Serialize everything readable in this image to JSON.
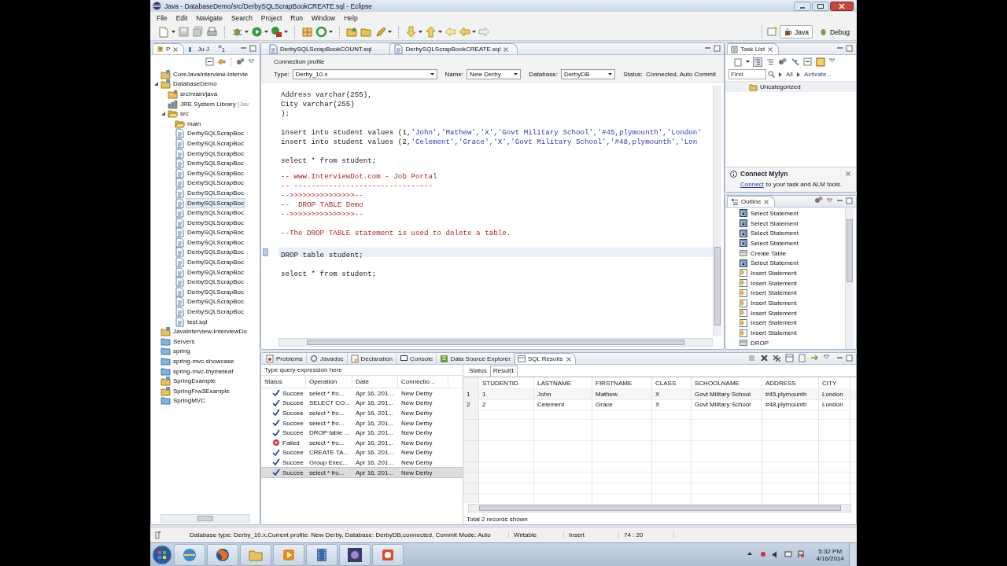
{
  "window": {
    "title": "Java - DatabaseDemo/src/DerbySQLScrapBookCREATE.sql - Eclipse"
  },
  "menu": [
    "File",
    "Edit",
    "Navigate",
    "Search",
    "Project",
    "Run",
    "Window",
    "Help"
  ],
  "perspectives": [
    {
      "label": "Java",
      "selected": true
    },
    {
      "label": "Debug",
      "selected": false
    }
  ],
  "explorer": {
    "tabs": [
      {
        "label": "P",
        "selected": true
      },
      {
        "label": "Ju J",
        "selected": false
      }
    ],
    "overflow": {
      "glyph": "»",
      "count": "1"
    },
    "tree": [
      {
        "label": "CoreJavaInterview-Intervie",
        "kind": "project",
        "selected": false
      },
      {
        "label": "DatabaseDemo",
        "kind": "project",
        "selected": false,
        "expanded": true,
        "children": [
          {
            "label": "src/main/java",
            "kind": "source",
            "selected": false
          },
          {
            "label": "JRE System Library",
            "suffix": "[Jav",
            "kind": "library",
            "selected": false
          },
          {
            "label": "src",
            "kind": "open",
            "selected": false,
            "expanded": true,
            "children": [
              {
                "label": "main",
                "kind": "open",
                "selected": false
              },
              {
                "label": "DerbySQLScrapBoc",
                "kind": "file",
                "selected": false
              },
              {
                "label": "DerbySQLScrapBoc",
                "kind": "file",
                "selected": false
              },
              {
                "label": "DerbySQLScrapBoc",
                "kind": "file",
                "selected": false
              },
              {
                "label": "DerbySQLScrapBoc",
                "kind": "file",
                "selected": false
              },
              {
                "label": "DerbySQLScrapBoc",
                "kind": "file",
                "selected": false
              },
              {
                "label": "DerbySQLScrapBoc",
                "kind": "file",
                "selected": false
              },
              {
                "label": "DerbySQLScrapBoc",
                "kind": "file",
                "selected": false
              },
              {
                "label": "DerbySQLScrapBoc",
                "kind": "file",
                "selected": true
              },
              {
                "label": "DerbySQLScrapBoc",
                "kind": "file",
                "selected": false
              },
              {
                "label": "DerbySQLScrapBoc",
                "kind": "file",
                "selected": false
              },
              {
                "label": "DerbySQLScrapBoc",
                "kind": "file",
                "selected": false
              },
              {
                "label": "DerbySQLScrapBoc",
                "kind": "file",
                "selected": false
              },
              {
                "label": "DerbySQLScrapBoc",
                "kind": "file",
                "selected": false
              },
              {
                "label": "DerbySQLScrapBoc",
                "kind": "file",
                "selected": false
              },
              {
                "label": "DerbySQLScrapBoc",
                "kind": "file",
                "selected": false
              },
              {
                "label": "DerbySQLScrapBoc",
                "kind": "file",
                "selected": false
              },
              {
                "label": "DerbySQLScrapBoc",
                "kind": "file",
                "selected": false
              },
              {
                "label": "DerbySQLScrapBoc",
                "kind": "file",
                "selected": false
              },
              {
                "label": "DerbySQLScrapBoc",
                "kind": "file",
                "selected": false
              },
              {
                "label": "test.sql",
                "kind": "file",
                "selected": false
              }
            ]
          }
        ]
      },
      {
        "label": "JavaInterview-InterviewDo",
        "kind": "project",
        "selected": false
      },
      {
        "label": "Servers",
        "kind": "folder",
        "selected": false
      },
      {
        "label": "spring",
        "kind": "folder",
        "selected": false
      },
      {
        "label": "spring-mvc-showcase",
        "kind": "folder",
        "selected": false
      },
      {
        "label": "spring-mvc-thymeleaf",
        "kind": "folder",
        "selected": false
      },
      {
        "label": "SpringExample",
        "kind": "project",
        "selected": false
      },
      {
        "label": "SpringFrw3Example",
        "kind": "project",
        "selected": false
      },
      {
        "label": "SpringMVC",
        "kind": "folder",
        "selected": false
      }
    ]
  },
  "editor": {
    "tabs": [
      {
        "label": "DerbySQLScrapBookCOUNT.sql",
        "selected": false
      },
      {
        "label": "DerbySQLScrapBookCREATE.sql",
        "selected": true
      }
    ],
    "connection": {
      "heading": "Connection profile",
      "fields": [
        {
          "label": "Type:",
          "value": "Derby_10.x"
        },
        {
          "label": "Name:",
          "value": "New Derby"
        },
        {
          "label": "Database:",
          "value": "DerbyDB"
        }
      ],
      "status_label": "Status:",
      "status": "Connected, Auto Commit"
    },
    "lines": [
      {
        "kind": "code",
        "current": false,
        "segments": [
          {
            "text": "Address varchar(255),",
            "kind": "plain"
          }
        ]
      },
      {
        "kind": "code",
        "current": false,
        "segments": [
          {
            "text": "City varchar(255)",
            "kind": "plain"
          }
        ]
      },
      {
        "kind": "code",
        "current": false,
        "segments": [
          {
            "text": ");",
            "kind": "plain"
          }
        ]
      },
      {
        "kind": "blank",
        "current": false
      },
      {
        "kind": "code",
        "current": false,
        "segments": [
          {
            "text": "insert into student values (1,",
            "kind": "plain"
          },
          {
            "text": "'John','Mathew','X','Govt Military School','#45,plymounth','London'",
            "kind": "string"
          }
        ]
      },
      {
        "kind": "code",
        "current": false,
        "segments": [
          {
            "text": "insert into student values (2,",
            "kind": "plain"
          },
          {
            "text": "'Celement','Grace','X','Govt Military School','#48,plymounth','Lon",
            "kind": "string"
          }
        ]
      },
      {
        "kind": "blank",
        "current": false
      },
      {
        "kind": "code",
        "current": false,
        "segments": [
          {
            "text": "select * from student;",
            "kind": "plain"
          }
        ]
      },
      {
        "kind": "blank",
        "current": false
      },
      {
        "kind": "comment",
        "current": false,
        "segments": [
          {
            "text": "-- www.InterviewDot.com - Job Portal",
            "kind": "plain"
          }
        ]
      },
      {
        "kind": "comment",
        "current": false,
        "segments": [
          {
            "text": "-- --------------------------------",
            "kind": "plain"
          }
        ]
      },
      {
        "kind": "comment",
        "current": false,
        "segments": [
          {
            "text": "-->>>>>>>>>>>>>>>--",
            "kind": "plain"
          }
        ]
      },
      {
        "kind": "comment",
        "current": false,
        "segments": [
          {
            "text": "--  DROP TABLE Demo",
            "kind": "plain"
          }
        ]
      },
      {
        "kind": "comment",
        "current": false,
        "segments": [
          {
            "text": "-->>>>>>>>>>>>>>>--",
            "kind": "plain"
          }
        ]
      },
      {
        "kind": "blank",
        "current": false
      },
      {
        "kind": "comment",
        "current": false,
        "segments": [
          {
            "text": "--The DROP TABLE statement is used to delete a table.",
            "kind": "plain"
          }
        ]
      },
      {
        "kind": "blank",
        "current": false
      },
      {
        "kind": "code",
        "current": true,
        "segments": [
          {
            "text": "DROP table student;",
            "kind": "plain"
          }
        ]
      },
      {
        "kind": "blank",
        "current": false
      },
      {
        "kind": "code",
        "current": false,
        "segments": [
          {
            "text": "select * from student;",
            "kind": "plain"
          }
        ]
      }
    ]
  },
  "task_list": {
    "title": "Task List",
    "find_placeholder": "Find",
    "filters": [
      "All",
      "Activate..."
    ],
    "categories": [
      "Uncategorized"
    ],
    "mylyn": {
      "title": "Connect Mylyn",
      "link": "Connect",
      "text": "to your task and ALM tools."
    }
  },
  "outline": {
    "title": "Outline",
    "items": [
      {
        "label": "Select Statement",
        "kind": "select"
      },
      {
        "label": "Select Statement",
        "kind": "select"
      },
      {
        "label": "Select Statement",
        "kind": "select"
      },
      {
        "label": "Select Statement",
        "kind": "select"
      },
      {
        "label": "Create Table",
        "kind": "table"
      },
      {
        "label": "Select Statement",
        "kind": "select"
      },
      {
        "label": "Insert Statement",
        "kind": "insert"
      },
      {
        "label": "Insert Statement",
        "kind": "insert"
      },
      {
        "label": "Insert Statement",
        "kind": "insert"
      },
      {
        "label": "Insert Statement",
        "kind": "insert"
      },
      {
        "label": "Insert Statement",
        "kind": "insert"
      },
      {
        "label": "Insert Statement",
        "kind": "insert"
      },
      {
        "label": "Insert Statement",
        "kind": "insert"
      },
      {
        "label": "DROP",
        "kind": "table"
      }
    ]
  },
  "bottom": {
    "tabs": [
      {
        "label": "Problems",
        "selected": false
      },
      {
        "label": "Javadoc",
        "selected": false
      },
      {
        "label": "Declaration",
        "selected": false
      },
      {
        "label": "Console",
        "selected": false
      },
      {
        "label": "Data Source Explorer",
        "selected": false
      },
      {
        "label": "SQL Results",
        "selected": true
      }
    ],
    "query_placeholder": "Type query expression here",
    "history": {
      "columns": [
        "Status",
        "Operation",
        "Date",
        "Connectio..."
      ],
      "rows": [
        {
          "kind": "success",
          "status": "Succee",
          "operation": "select * fro...",
          "date": "Apr 16, 201...",
          "connection": "New Derby",
          "selected": false
        },
        {
          "kind": "success",
          "status": "Succee",
          "operation": "SELECT CO...",
          "date": "Apr 16, 201...",
          "connection": "New Derby",
          "selected": false
        },
        {
          "kind": "success",
          "status": "Succee",
          "operation": "select * fro...",
          "date": "Apr 16, 201...",
          "connection": "New Derby",
          "selected": false
        },
        {
          "kind": "success",
          "status": "Succee",
          "operation": "select * fro...",
          "date": "Apr 16, 201...",
          "connection": "New Derby",
          "selected": false
        },
        {
          "kind": "success",
          "status": "Succee",
          "operation": "DROP table ...",
          "date": "Apr 16, 201...",
          "connection": "New Derby",
          "selected": false
        },
        {
          "kind": "failed",
          "status": "Failed",
          "operation": "select * fro...",
          "date": "Apr 16, 201...",
          "connection": "New Derby",
          "selected": false
        },
        {
          "kind": "success",
          "status": "Succee",
          "operation": "CREATE TA...",
          "date": "Apr 16, 201...",
          "connection": "New Derby",
          "selected": false
        },
        {
          "kind": "success",
          "status": "Succee",
          "operation": "Group Exec...",
          "date": "Apr 16, 201...",
          "connection": "New Derby",
          "selected": false
        },
        {
          "kind": "success",
          "status": "Succee",
          "operation": "select * fro...",
          "date": "Apr 16, 201...",
          "connection": "New Derby",
          "selected": true
        }
      ]
    },
    "results": {
      "tabs": [
        {
          "label": "Status",
          "selected": false
        },
        {
          "label": "Result1",
          "selected": true
        }
      ],
      "columns": [
        "STUDENTID",
        "LASTNAME",
        "FIRSTNAME",
        "CLASS",
        "SCHOOLNAME",
        "ADDRESS",
        "CITY"
      ],
      "rows": [
        {
          "number": "1",
          "cells": [
            "1",
            "John",
            "Mathew",
            "X",
            "Govt Military School",
            "#45,plymounth",
            "London"
          ]
        },
        {
          "number": "2",
          "cells": [
            "2",
            "Celement",
            "Grace",
            "X",
            "Govt Military School",
            "#48,plymounth",
            "London"
          ]
        }
      ],
      "footer": "Total 2 records shown"
    }
  },
  "status_bar": {
    "message": "Database type: Derby_10.x,Current profile: New Derby, Database: DerbyDB,connected, Commit Mode: Auto",
    "fields": [
      "Writable",
      "Insert",
      "74 : 20"
    ]
  },
  "taskbar": {
    "time": "5:32 PM",
    "date": "4/16/2014"
  }
}
